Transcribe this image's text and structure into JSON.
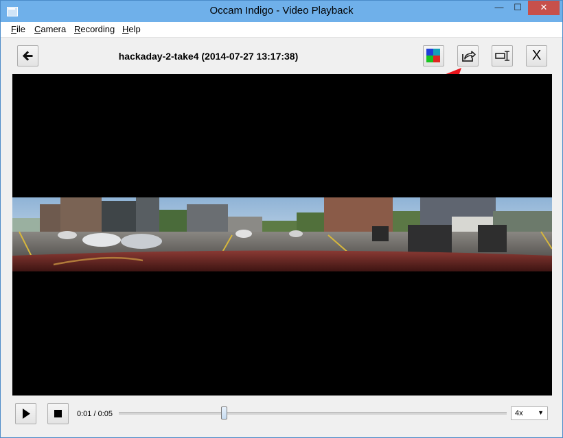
{
  "window": {
    "title": "Occam Indigo - Video Playback",
    "controls": {
      "minimize": "—",
      "maximize": "☐",
      "close": "✕"
    }
  },
  "menu": [
    {
      "label": "File",
      "mnemonic": "F",
      "rest": "ile"
    },
    {
      "label": "Camera",
      "mnemonic": "C",
      "rest": "amera"
    },
    {
      "label": "Recording",
      "mnemonic": "R",
      "rest": "ecording"
    },
    {
      "label": "Help",
      "mnemonic": "H",
      "rest": "elp"
    }
  ],
  "toolbar": {
    "back_icon": "arrow-left-icon",
    "video_title": "hackaday-2-take4 (2014-07-27 13:17:38)",
    "buttons": [
      {
        "name": "color-mode-icon",
        "colors": [
          "#1f3fd8",
          "#18c41f",
          "#14a0b8",
          "#e0261f"
        ]
      },
      {
        "name": "share-export-icon"
      },
      {
        "name": "text-cursor-icon"
      },
      {
        "name": "close-video",
        "label": "X"
      }
    ]
  },
  "annotation": {
    "color": "#e8141b",
    "icon": "red-arrow-pointer"
  },
  "playback": {
    "time": "0:01 / 0:05",
    "progress_fraction": 0.27,
    "speed": "4x",
    "play_icon": "play-icon",
    "stop_icon": "stop-icon"
  }
}
